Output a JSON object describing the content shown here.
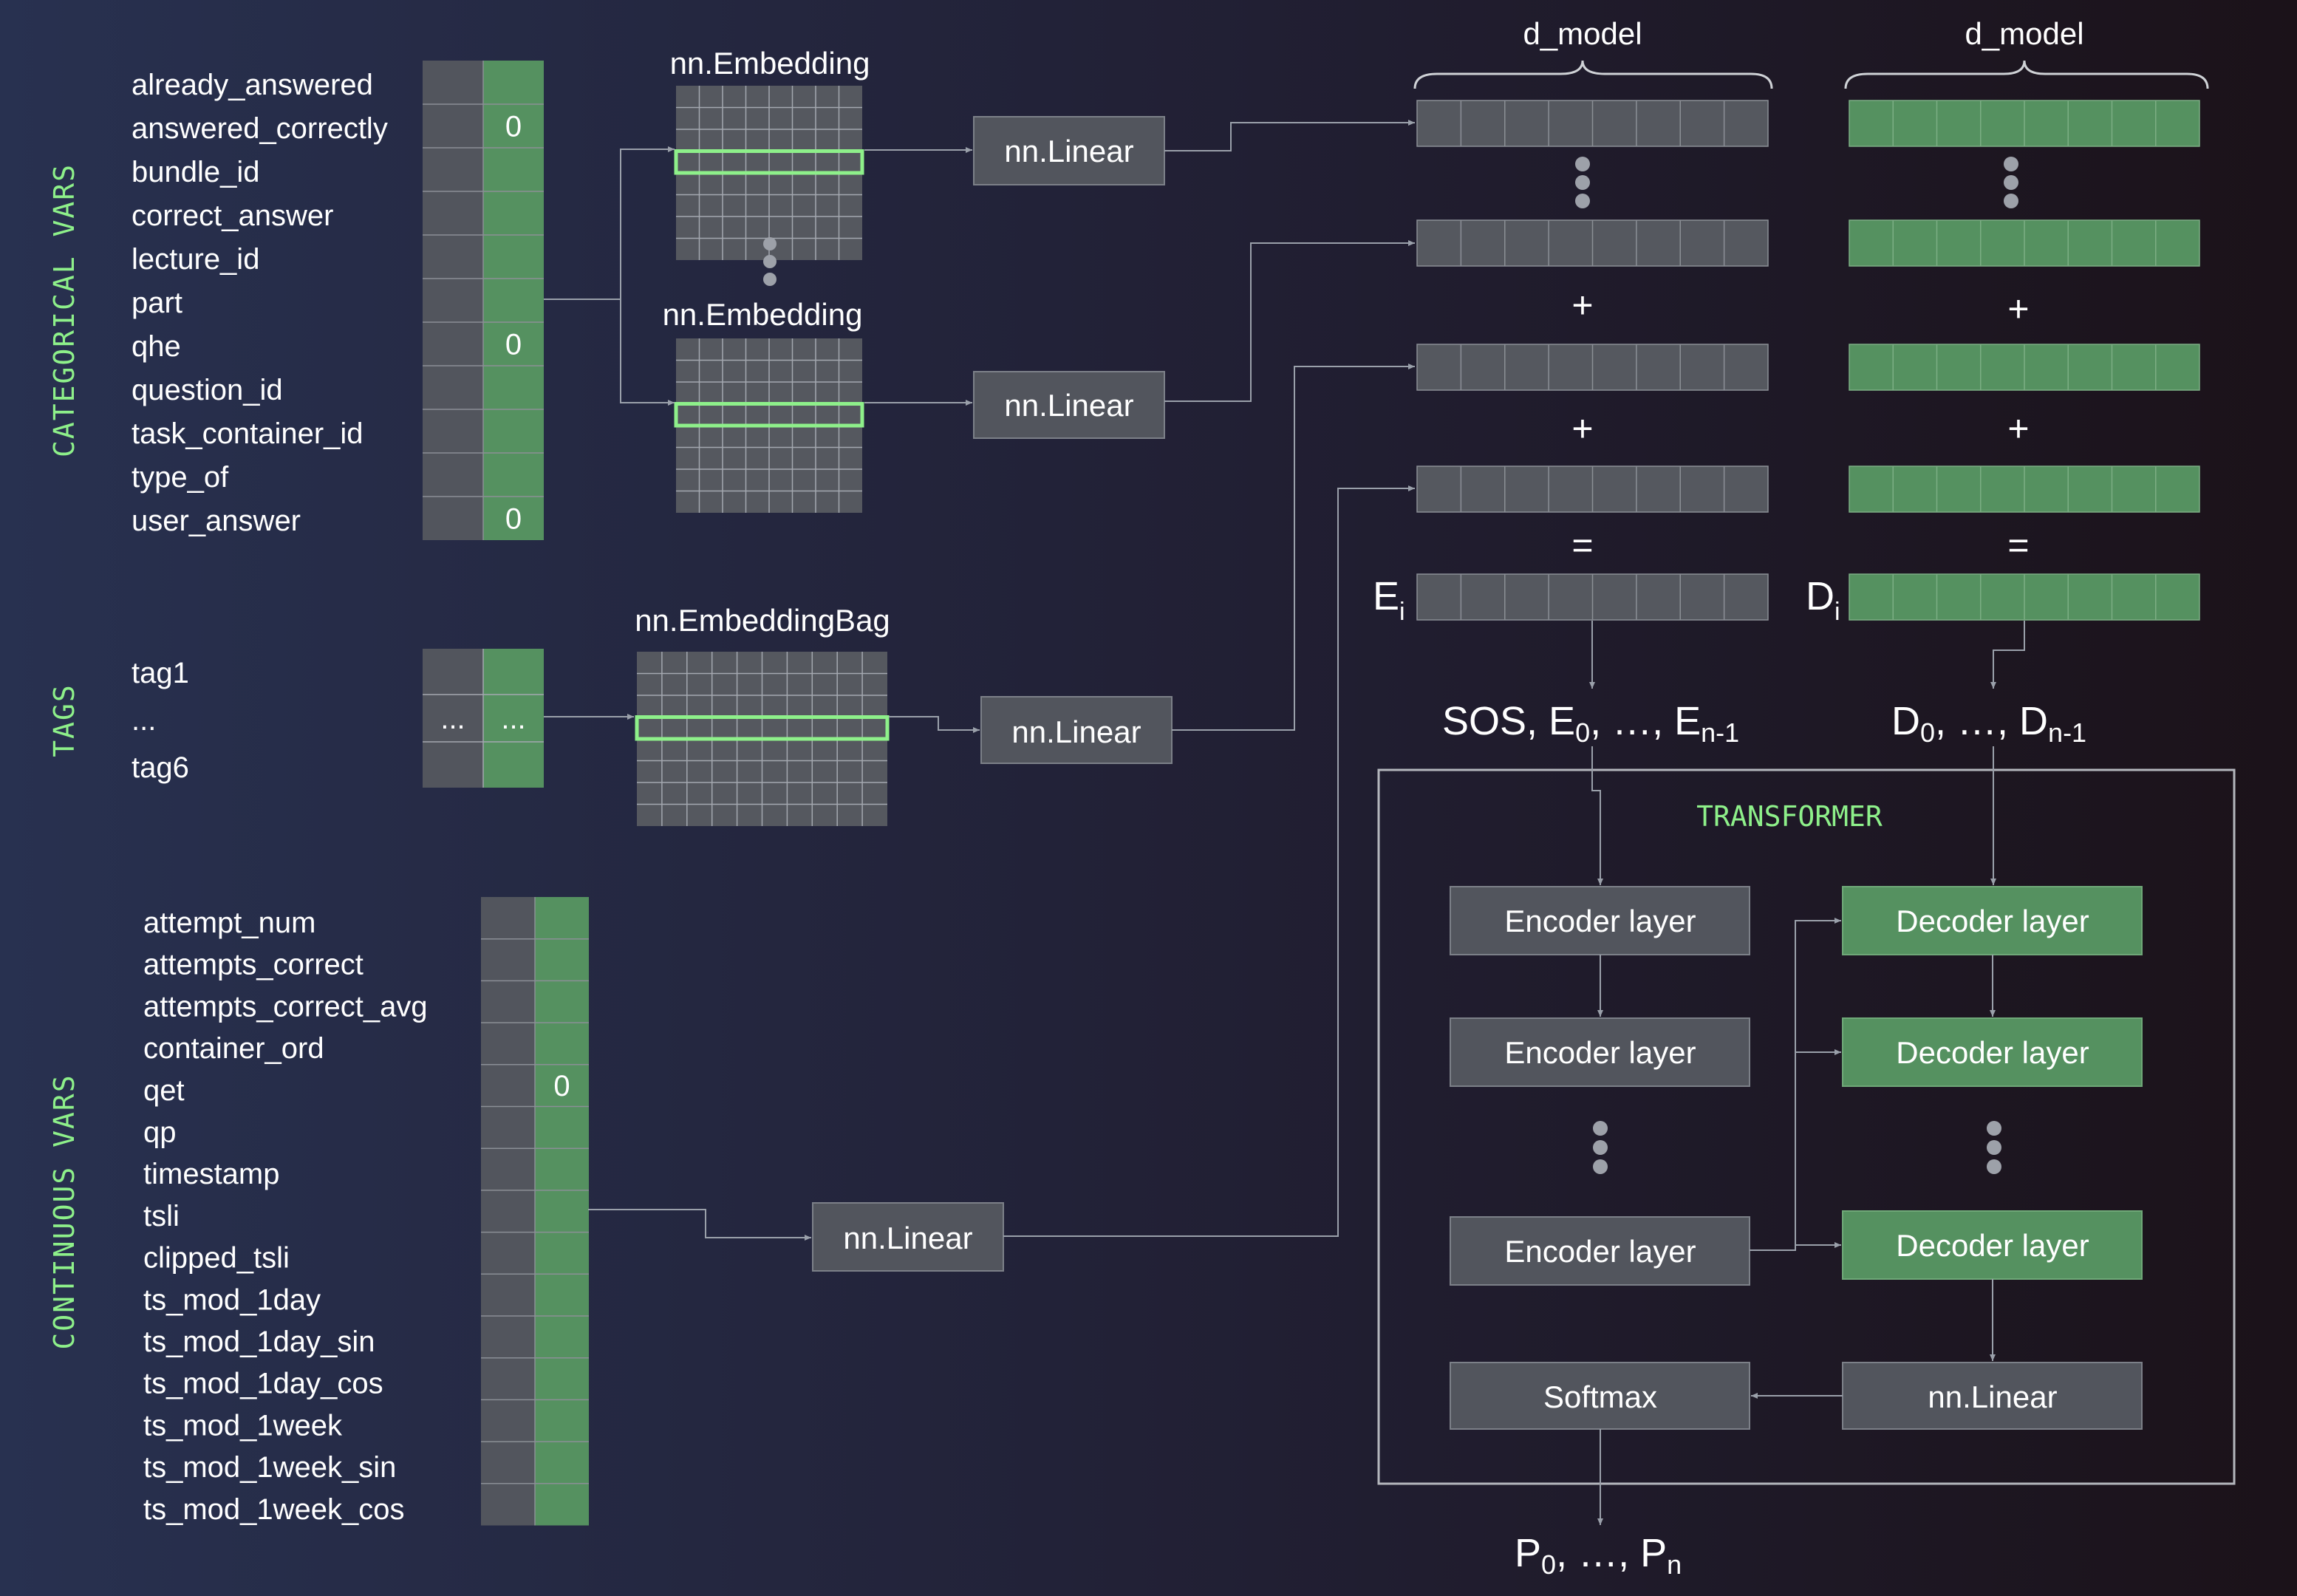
{
  "side_labels": {
    "categorical": "CATEGORICAL VARS",
    "tags": "TAGS",
    "continuous": "CONTINUOUS VARS"
  },
  "categorical_vars": [
    {
      "name": "already_answered",
      "value": ""
    },
    {
      "name": "answered_correctly",
      "value": "0"
    },
    {
      "name": "bundle_id",
      "value": ""
    },
    {
      "name": "correct_answer",
      "value": ""
    },
    {
      "name": "lecture_id",
      "value": ""
    },
    {
      "name": "part",
      "value": ""
    },
    {
      "name": "qhe",
      "value": "0"
    },
    {
      "name": "question_id",
      "value": ""
    },
    {
      "name": "task_container_id",
      "value": ""
    },
    {
      "name": "type_of",
      "value": ""
    },
    {
      "name": "user_answer",
      "value": "0"
    }
  ],
  "tags": {
    "items": [
      "tag1",
      "...",
      "tag6"
    ],
    "cell_left": "...",
    "cell_right": "..."
  },
  "continuous_vars": [
    {
      "name": "attempt_num",
      "value": ""
    },
    {
      "name": "attempts_correct",
      "value": ""
    },
    {
      "name": "attempts_correct_avg",
      "value": ""
    },
    {
      "name": "container_ord",
      "value": ""
    },
    {
      "name": "qet",
      "value": "0"
    },
    {
      "name": "qp",
      "value": ""
    },
    {
      "name": "timestamp",
      "value": ""
    },
    {
      "name": "tsli",
      "value": ""
    },
    {
      "name": "clipped_tsli",
      "value": ""
    },
    {
      "name": "ts_mod_1day",
      "value": ""
    },
    {
      "name": "ts_mod_1day_sin",
      "value": ""
    },
    {
      "name": "ts_mod_1day_cos",
      "value": ""
    },
    {
      "name": "ts_mod_1week",
      "value": ""
    },
    {
      "name": "ts_mod_1week_sin",
      "value": ""
    },
    {
      "name": "ts_mod_1week_cos",
      "value": ""
    }
  ],
  "modules": {
    "embedding": "nn.Embedding",
    "embedding_bag": "nn.EmbeddingBag",
    "linear": "nn.Linear"
  },
  "sum_block": {
    "d_model": "d_model",
    "plus": "+",
    "equals": "=",
    "e_label": "E",
    "e_sub": "i",
    "d_label": "D",
    "d_sub": "i"
  },
  "sequences": {
    "encoder_in_prefix": "SOS, E",
    "encoder_in_sub0": "0",
    "encoder_in_mid": ", …, E",
    "encoder_in_subn": "n-1",
    "decoder_in_prefix": "D",
    "decoder_in_sub0": "0",
    "decoder_in_mid": ", …, D",
    "decoder_in_subn": "n-1",
    "output_prefix": "P",
    "output_sub0": "0",
    "output_mid": ", …, P",
    "output_subn": "n"
  },
  "transformer": {
    "title": "TRANSFORMER",
    "encoder_layer": "Encoder layer",
    "decoder_layer": "Decoder layer",
    "linear": "nn.Linear",
    "softmax": "Softmax"
  },
  "colors": {
    "gray_box": "#52555d",
    "green_box": "#559160",
    "highlight": "#8ef08a",
    "text": "#ffffff"
  }
}
